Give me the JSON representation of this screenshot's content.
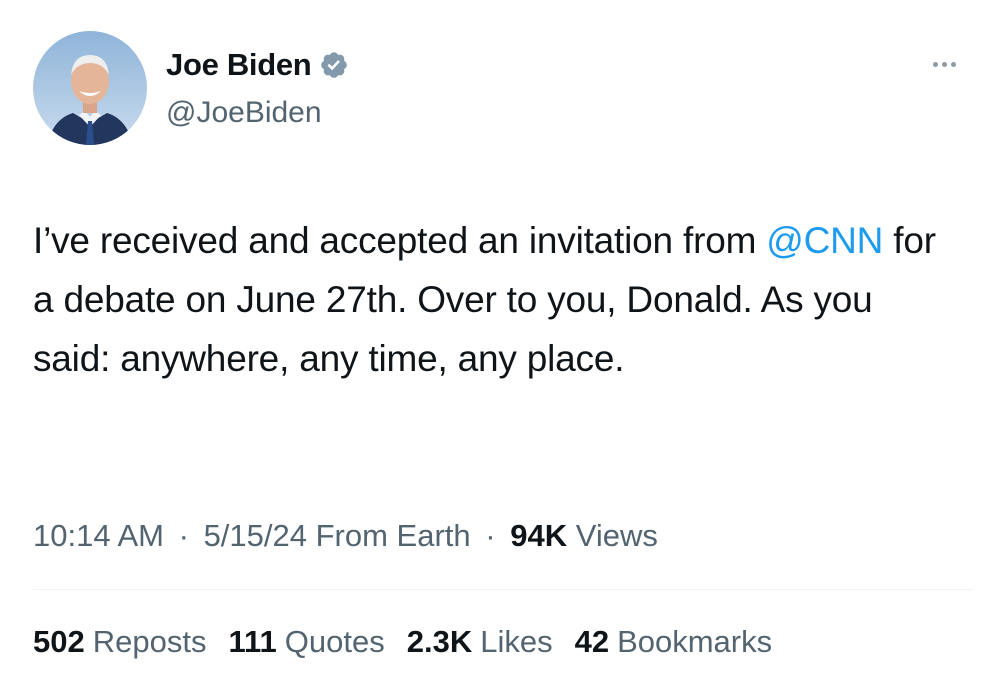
{
  "author": {
    "display_name": "Joe Biden",
    "handle": "@JoeBiden",
    "avatar_icon": "profile-photo",
    "verified_icon": "verified-badge-icon"
  },
  "tweet": {
    "text_before": "I’ve received and accepted an invitation from ",
    "mention": "@CNN",
    "text_after": " for a debate on June 27th. Over to you, Donald. As you said: anywhere, any time, any place."
  },
  "meta": {
    "time": "10:14 AM",
    "separator": "·",
    "date": "5/15/24",
    "source": "From Earth",
    "views_count": "94K",
    "views_label": "Views"
  },
  "stats": {
    "reposts_count": "502",
    "reposts_label": "Reposts",
    "quotes_count": "111",
    "quotes_label": "Quotes",
    "likes_count": "2.3K",
    "likes_label": "Likes",
    "bookmarks_count": "42",
    "bookmarks_label": "Bookmarks"
  },
  "colors": {
    "accent": "#1d9bf0",
    "secondary_text": "#536471",
    "verified": "#829aab"
  }
}
